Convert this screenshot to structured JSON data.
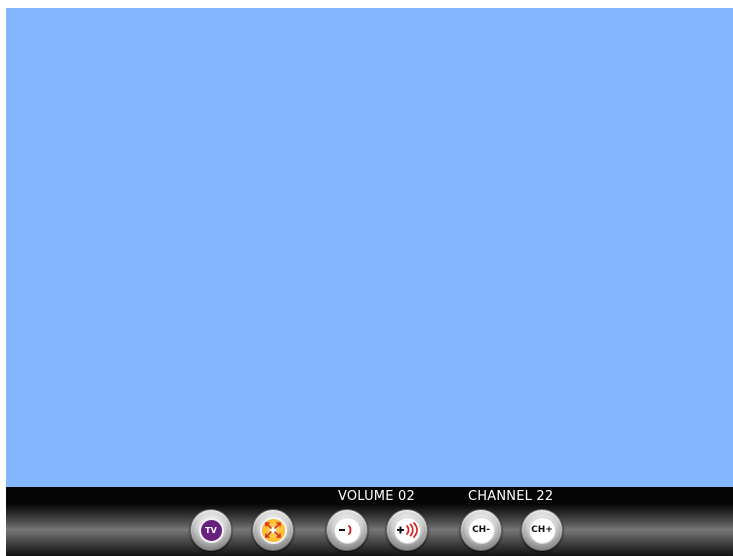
{
  "status": {
    "volume_text": "VOLUME 02",
    "channel_text": "CHANNEL 22"
  },
  "controls": {
    "tv": {
      "label": "TV",
      "icon": "tv-icon",
      "color": "#68207f"
    },
    "zoom": {
      "icon": "expand-icon",
      "color": "#ffbb2f"
    },
    "volume_down": {
      "label": "-",
      "icon": "volume-down-icon",
      "color": "#d81f1f"
    },
    "volume_up": {
      "label": "+",
      "icon": "volume-up-icon",
      "color": "#d81f1f"
    },
    "channel_down": {
      "label": "CH-",
      "icon": "channel-down-icon"
    },
    "channel_up": {
      "label": "CH+",
      "icon": "channel-up-icon"
    }
  },
  "colors": {
    "viewport": "#84b6ff",
    "control_bar": "#050505",
    "text": "#ffffff"
  }
}
